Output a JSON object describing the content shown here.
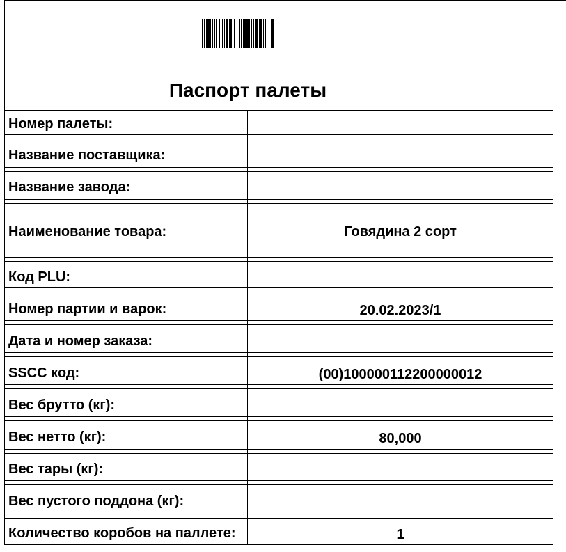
{
  "document": {
    "title": "Паспорт палеты",
    "barcode_icon": "barcode-image",
    "rows": [
      {
        "label": "Номер палеты:",
        "value": ""
      },
      {
        "label": "Название поставщика:",
        "value": ""
      },
      {
        "label": "Название завода:",
        "value": ""
      },
      {
        "label": "Наименование товара:",
        "value": "Говядина 2 сорт"
      },
      {
        "label": "Код PLU:",
        "value": ""
      },
      {
        "label": "Номер партии и варок:",
        "value": "20.02.2023/1"
      },
      {
        "label": "Дата и номер заказа:",
        "value": ""
      },
      {
        "label": "SSCC код:",
        "value": "(00)100000112200000012"
      },
      {
        "label": "Вес брутто (кг):",
        "value": ""
      },
      {
        "label": "Вес нетто (кг):",
        "value": "80,000"
      },
      {
        "label": "Вес тары (кг):",
        "value": ""
      },
      {
        "label": "Вес пустого поддона (кг):",
        "value": ""
      },
      {
        "label": "Количество коробов на паллете:",
        "value": "1"
      }
    ]
  }
}
